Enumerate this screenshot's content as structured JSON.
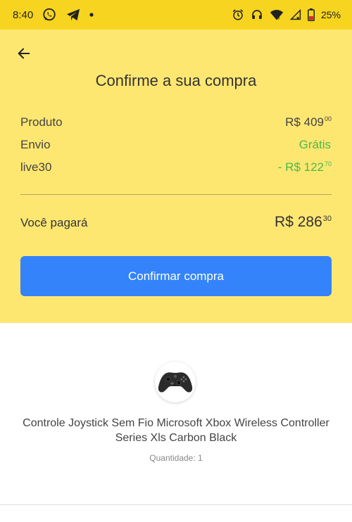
{
  "status_bar": {
    "time": "8:40",
    "battery": "25%"
  },
  "header": {
    "title": "Confirme a sua compra"
  },
  "summary": {
    "rows": [
      {
        "label": "Produto",
        "value_main": "R$ 409",
        "value_cents": "00"
      },
      {
        "label": "Envio",
        "value_main": "Grátis",
        "value_cents": ""
      },
      {
        "label": "live30",
        "value_main": "- R$ 122",
        "value_cents": "70"
      }
    ],
    "total": {
      "label": "Você pagará",
      "value_main": "R$ 286",
      "value_cents": "30"
    }
  },
  "actions": {
    "confirm_label": "Confirmar compra"
  },
  "product": {
    "name": "Controle Joystick Sem Fio Microsoft Xbox Wireless Controller Series Xls Carbon Black",
    "quantity": "Quantidade: 1"
  },
  "colors": {
    "status_bar_bg": "#f6d41f",
    "summary_bg": "#fee771",
    "accent_blue": "#3483fa",
    "green": "#49b94a"
  },
  "icons": [
    "whatsapp-icon",
    "telegram-icon",
    "notification-dot-icon",
    "alarm-icon",
    "headset-icon",
    "wifi-icon",
    "signal-icon",
    "battery-icon",
    "back-arrow-icon"
  ]
}
